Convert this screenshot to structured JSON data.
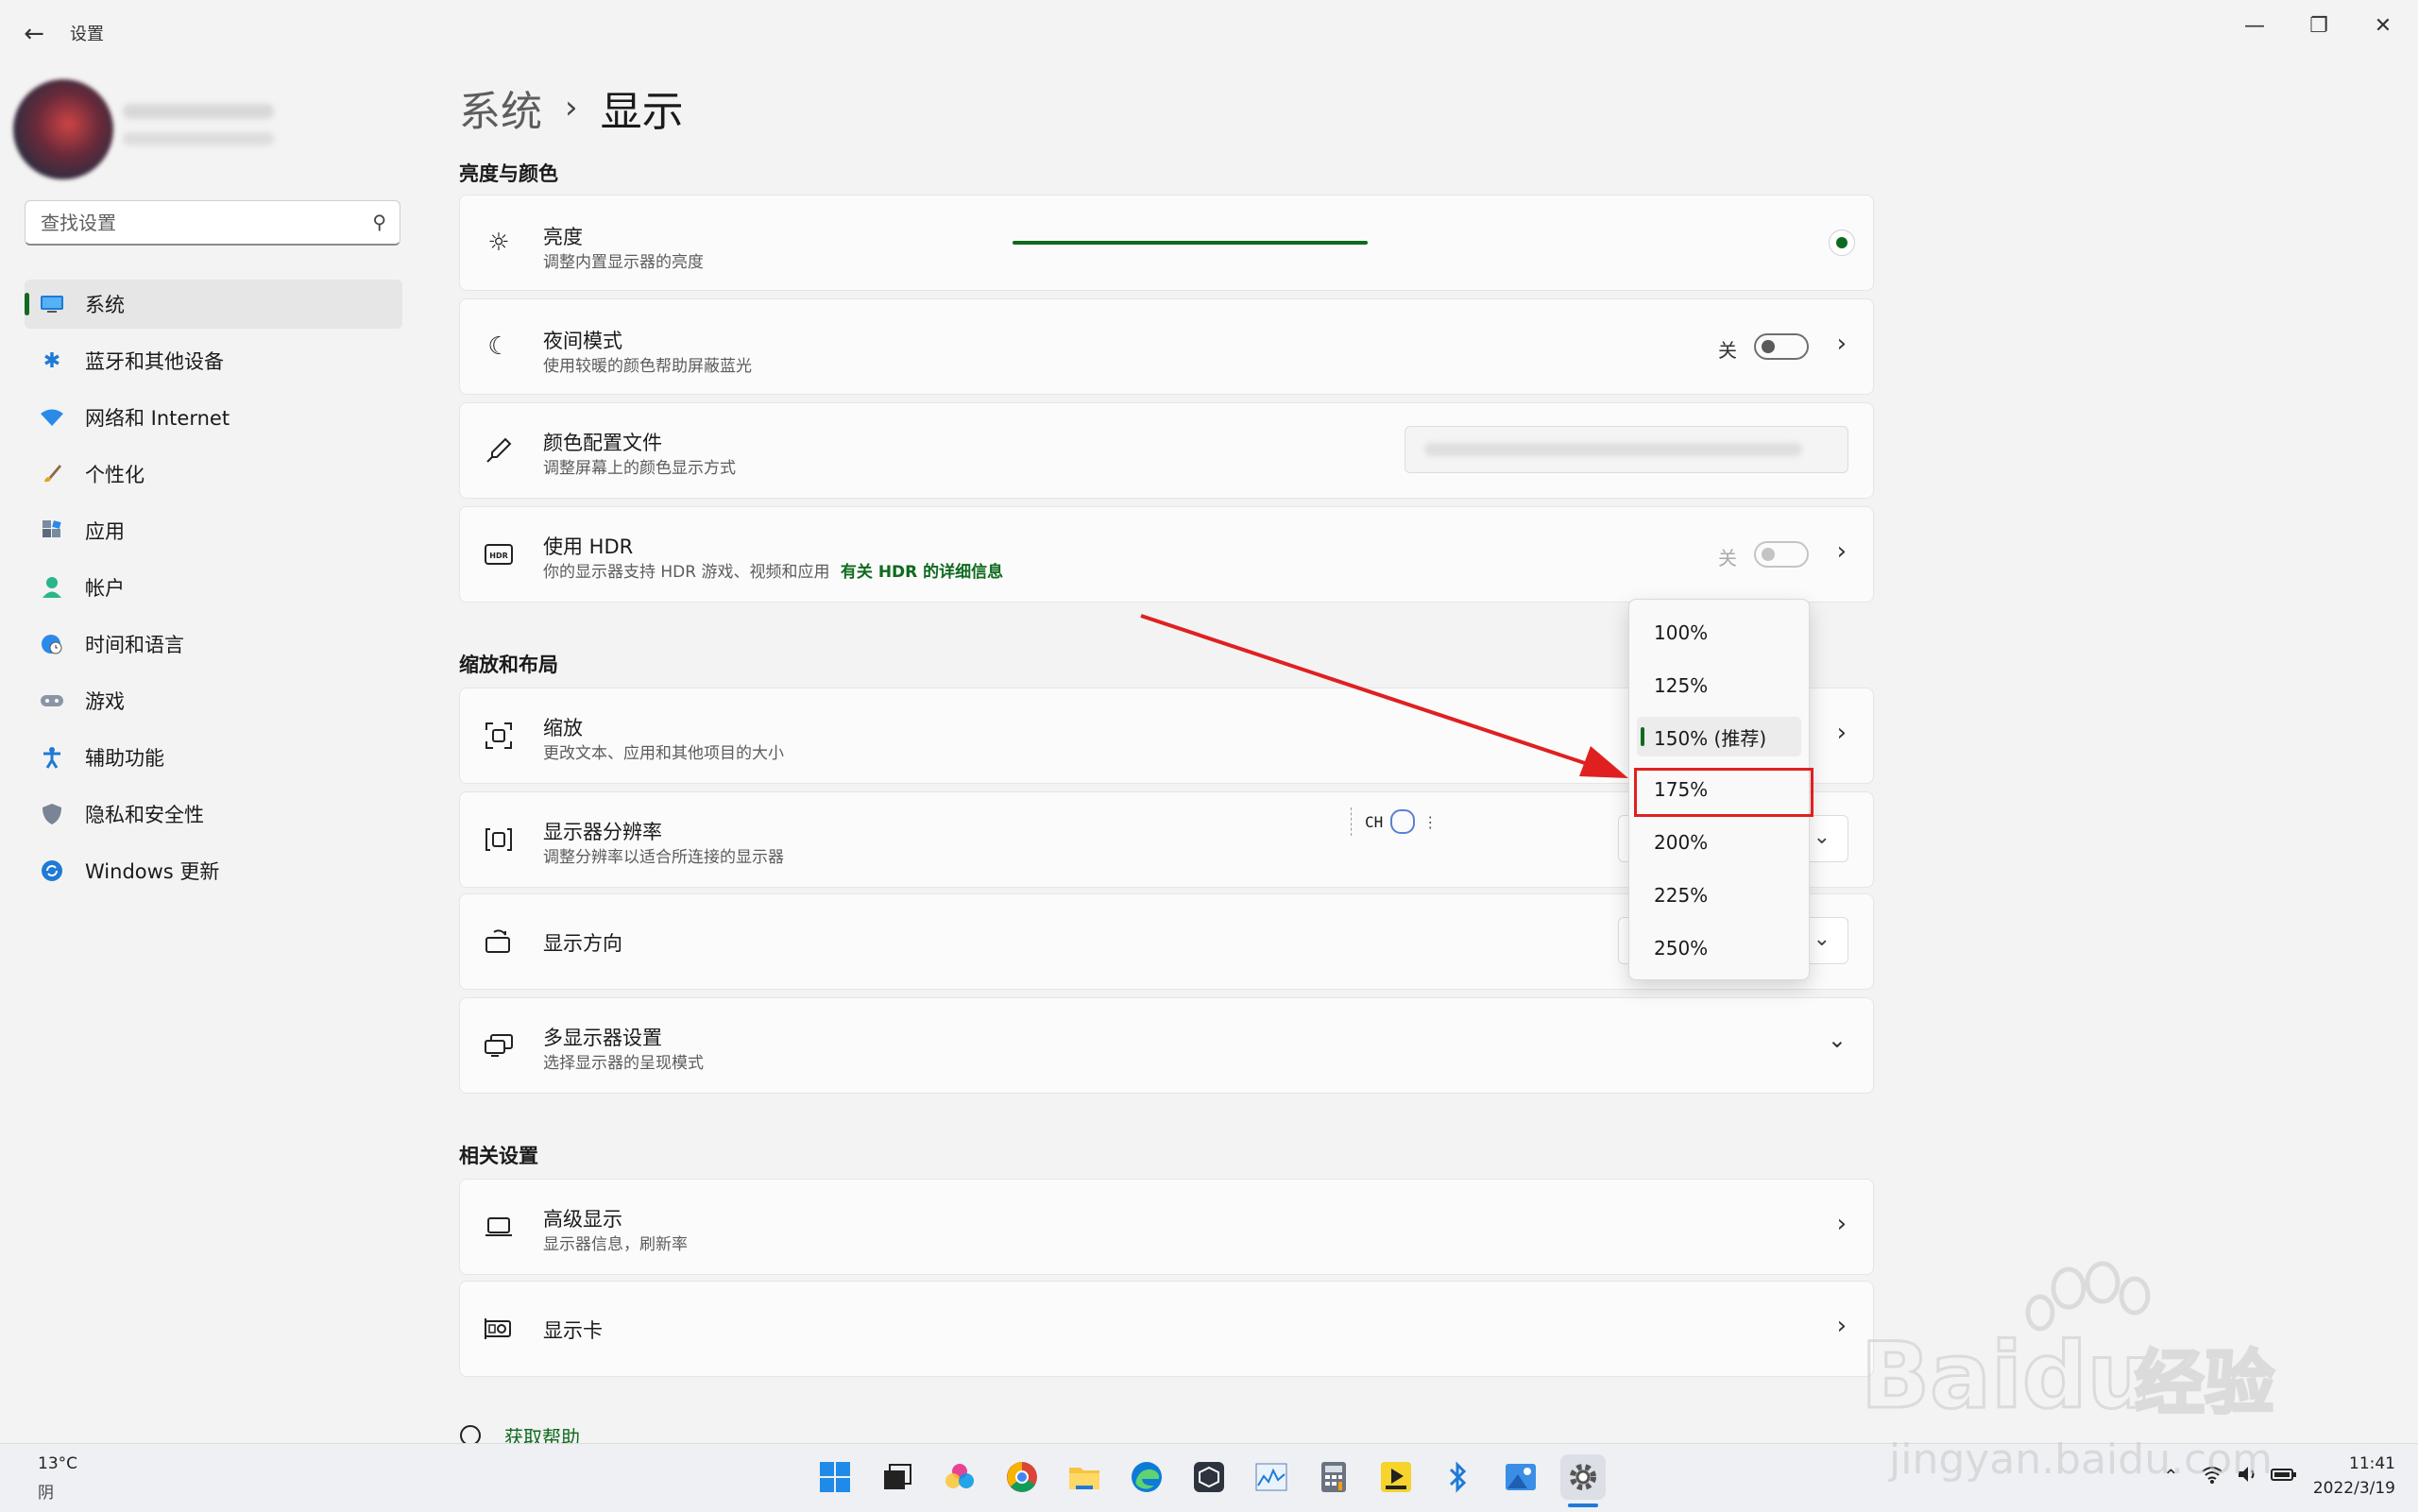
{
  "window": {
    "app_title": "设置",
    "controls": {
      "minimize": "—",
      "maximize": "❐",
      "close": "✕"
    }
  },
  "search": {
    "placeholder": "查找设置"
  },
  "sidebar": {
    "items": [
      {
        "label": "系统",
        "icon": "monitor-icon"
      },
      {
        "label": "蓝牙和其他设备",
        "icon": "bluetooth-icon"
      },
      {
        "label": "网络和 Internet",
        "icon": "wifi-icon"
      },
      {
        "label": "个性化",
        "icon": "brush-icon"
      },
      {
        "label": "应用",
        "icon": "apps-icon"
      },
      {
        "label": "帐户",
        "icon": "person-icon"
      },
      {
        "label": "时间和语言",
        "icon": "globe-clock-icon"
      },
      {
        "label": "游戏",
        "icon": "gamepad-icon"
      },
      {
        "label": "辅助功能",
        "icon": "accessibility-icon"
      },
      {
        "label": "隐私和安全性",
        "icon": "shield-icon"
      },
      {
        "label": "Windows 更新",
        "icon": "update-icon"
      }
    ],
    "active_index": 0
  },
  "breadcrumb": {
    "parent": "系统",
    "separator": "›",
    "current": "显示"
  },
  "sections": {
    "brightness_color": "亮度与颜色",
    "scale_layout": "缩放和布局",
    "related": "相关设置"
  },
  "cards": {
    "brightness": {
      "title": "亮度",
      "subtitle": "调整内置显示器的亮度",
      "level_percent": 100
    },
    "night": {
      "title": "夜间模式",
      "subtitle": "使用较暖的颜色帮助屏蔽蓝光",
      "state": "关"
    },
    "color_profile": {
      "title": "颜色配置文件",
      "subtitle": "调整屏幕上的颜色显示方式"
    },
    "hdr": {
      "title": "使用 HDR",
      "subtitle": "你的显示器支持 HDR 游戏、视频和应用",
      "link": "有关 HDR 的详细信息",
      "state": "关"
    },
    "scale": {
      "title": "缩放",
      "subtitle": "更改文本、应用和其他项目的大小"
    },
    "resolution": {
      "title": "显示器分辨率",
      "subtitle": "调整分辨率以适合所连接的显示器"
    },
    "orientation": {
      "title": "显示方向"
    },
    "multi": {
      "title": "多显示器设置",
      "subtitle": "选择显示器的呈现模式"
    },
    "advanced": {
      "title": "高级显示",
      "subtitle": "显示器信息，刷新率"
    },
    "gpu": {
      "title": "显示卡"
    }
  },
  "scale_popup": {
    "options": [
      "100%",
      "125%",
      "150% (推荐)",
      "175%",
      "200%",
      "225%",
      "250%"
    ],
    "selected_index": 2,
    "highlighted_index": 3
  },
  "ime": {
    "lang": "CH"
  },
  "help": {
    "label": "获取帮助"
  },
  "taskbar": {
    "weather_temp": "13°C",
    "weather_desc": "阴",
    "time": "11:41",
    "date": "2022/3/19"
  },
  "watermark": {
    "brand": "Baidu",
    "cn": "经验",
    "url": "jingyan.baidu.com"
  }
}
